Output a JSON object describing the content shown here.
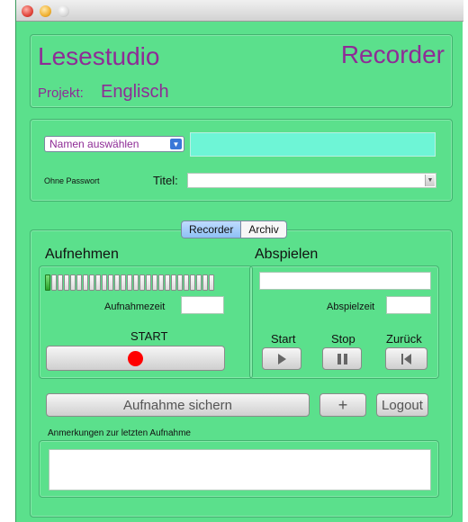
{
  "header": {
    "app_name": "Lesestudio",
    "mode_title": "Recorder",
    "project_label": "Projekt:",
    "project_value": "Englisch"
  },
  "login": {
    "name_select_label": "Namen auswählen",
    "name_field_value": "",
    "password_label": "Ohne Passwort",
    "title_label": "Titel:",
    "title_value": ""
  },
  "tabs": [
    {
      "label": "Recorder",
      "active": true
    },
    {
      "label": "Archiv",
      "active": false
    }
  ],
  "record": {
    "heading": "Aufnehmen",
    "time_label": "Aufnahmezeit",
    "time_value": "",
    "start_label": "START",
    "level_segments": 27,
    "level_active": 1,
    "record_color": "#ff0000"
  },
  "playback": {
    "heading": "Abspielen",
    "file_value": "",
    "time_label": "Abspielzeit",
    "time_value": "",
    "start_label": "Start",
    "stop_label": "Stop",
    "back_label": "Zurück"
  },
  "actions": {
    "save_label": "Aufnahme sichern",
    "add_label": "+",
    "logout_label": "Logout"
  },
  "notes": {
    "label": "Anmerkungen zur letzten Aufnahme",
    "value": ""
  },
  "colors": {
    "background": "#5be08c",
    "accent_text": "#8e2c96",
    "name_field": "#6ef5d6"
  }
}
